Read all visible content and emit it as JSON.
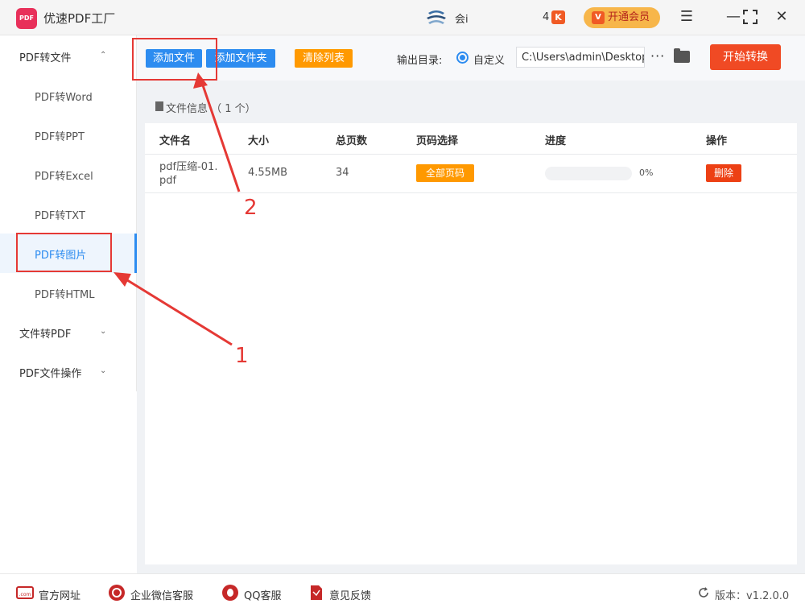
{
  "app": {
    "title": "优速PDF工厂",
    "logo_text": "PDF"
  },
  "titlebar": {
    "user_name": "会i",
    "notification_count": "4",
    "vip_label": "开通会员"
  },
  "sidebar": {
    "groups": [
      {
        "label": "PDF转文件",
        "expanded": true
      },
      {
        "label": "文件转PDF",
        "expanded": false
      },
      {
        "label": "PDF文件操作",
        "expanded": false
      }
    ],
    "items": [
      {
        "label": "PDF转Word"
      },
      {
        "label": "PDF转PPT"
      },
      {
        "label": "PDF转Excel"
      },
      {
        "label": "PDF转TXT"
      },
      {
        "label": "PDF转图片",
        "active": true
      },
      {
        "label": "PDF转HTML"
      }
    ]
  },
  "toolbar": {
    "add_file": "添加文件",
    "add_folder": "添加文件夹",
    "clear_list": "清除列表",
    "output_label": "输出目录:",
    "radio_label": "自定义",
    "output_path": "C:\\Users\\admin\\Desktop",
    "more": "···",
    "start": "开始转换"
  },
  "panel": {
    "header": "文件信息 （ 1 个）",
    "columns": [
      "文件名",
      "大小",
      "总页数",
      "页码选择",
      "进度",
      "操作"
    ],
    "rows": [
      {
        "name_line1": "pdf压缩-01.",
        "name_line2": "pdf",
        "size": "4.55MB",
        "pages": "34",
        "page_select": "全部页码",
        "progress": 0,
        "progress_text": "0%",
        "action": "删除"
      }
    ]
  },
  "footer": {
    "links": [
      "官方网址",
      "企业微信客服",
      "QQ客服",
      "意见反馈"
    ],
    "version": "版本：v1.2.0.0"
  },
  "annotations": [
    "1",
    "2"
  ],
  "colors": {
    "primary": "#2d8cf0",
    "danger": "#ed4014",
    "warning": "#ff9900",
    "start": "#f04a24",
    "annotation": "#e53935"
  }
}
